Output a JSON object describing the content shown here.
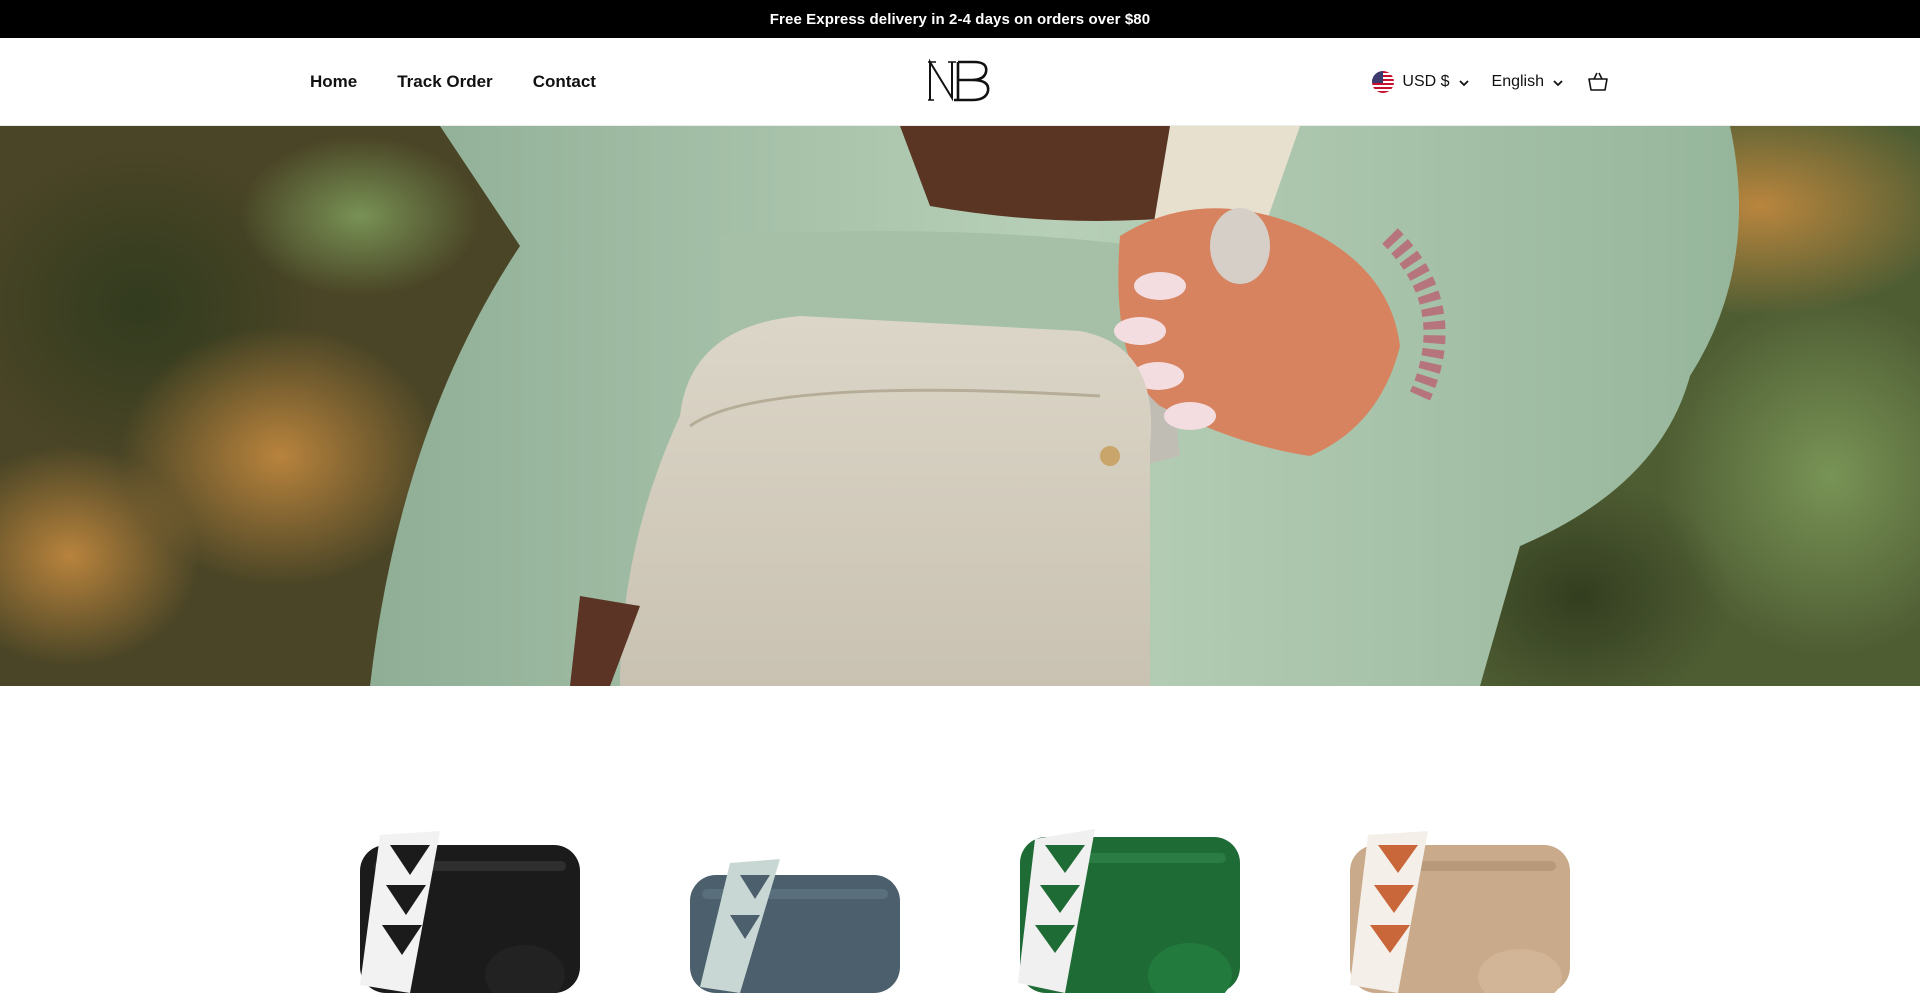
{
  "announcement": {
    "text": "Free Express delivery in 2-4 days on orders over $80"
  },
  "nav": {
    "items": [
      {
        "label": "Home"
      },
      {
        "label": "Track Order"
      },
      {
        "label": "Contact"
      }
    ]
  },
  "logo": {
    "text": "NB"
  },
  "header": {
    "currency": {
      "label": "USD $",
      "icon": "us-flag-icon"
    },
    "language": {
      "label": "English"
    },
    "cart_icon": "basket-icon"
  },
  "hero": {
    "image": "woman holding beige crossbody bag with patterned strap"
  },
  "products": [
    {
      "color_name": "black",
      "color": "#1b1b1b",
      "strap_color": "#f2f2f2"
    },
    {
      "color_name": "slate blue",
      "color": "#4b5f6c",
      "strap_color": "#c9d7d4"
    },
    {
      "color_name": "green",
      "color": "#1f6b36",
      "strap_color": "#f0f0f0"
    },
    {
      "color_name": "taupe",
      "color": "#c9ab8b",
      "strap_color": "#c9663a"
    }
  ],
  "colors": {
    "announcement_bg": "#000000",
    "announcement_text": "#ffffff",
    "header_bg": "#ffffff"
  }
}
